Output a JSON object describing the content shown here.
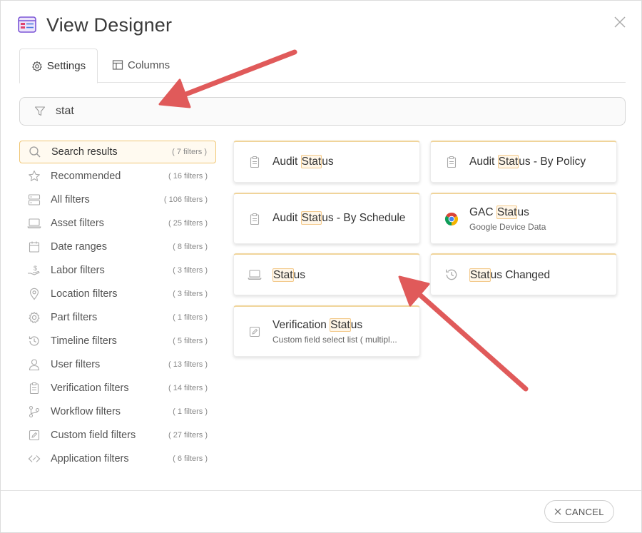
{
  "dialog": {
    "title": "View Designer",
    "close_icon": "close-icon",
    "logo_icon": "view-designer-logo-icon"
  },
  "tabs": [
    {
      "label": "Settings",
      "icon": "gear-icon",
      "active": true
    },
    {
      "label": "Columns",
      "icon": "columns-icon",
      "active": false
    }
  ],
  "search": {
    "value": "stat",
    "icon": "filter-icon"
  },
  "sidebar": {
    "items": [
      {
        "label": "Search results",
        "count": "( 7 filters )",
        "icon": "search-icon",
        "active": true
      },
      {
        "label": "Recommended",
        "count": "( 16 filters )",
        "icon": "star-icon"
      },
      {
        "label": "All filters",
        "count": "( 106 filters )",
        "icon": "server-icon"
      },
      {
        "label": "Asset filters",
        "count": "( 25 filters )",
        "icon": "laptop-icon"
      },
      {
        "label": "Date ranges",
        "count": "( 8 filters )",
        "icon": "calendar-icon"
      },
      {
        "label": "Labor filters",
        "count": "( 3 filters )",
        "icon": "hand-money-icon"
      },
      {
        "label": "Location filters",
        "count": "( 3 filters )",
        "icon": "location-pin-icon"
      },
      {
        "label": "Part filters",
        "count": "( 1 filters )",
        "icon": "gear-icon"
      },
      {
        "label": "Timeline filters",
        "count": "( 5 filters )",
        "icon": "history-icon"
      },
      {
        "label": "User filters",
        "count": "( 13 filters )",
        "icon": "user-icon"
      },
      {
        "label": "Verification filters",
        "count": "( 14 filters )",
        "icon": "clipboard-icon"
      },
      {
        "label": "Workflow filters",
        "count": "( 1 filters )",
        "icon": "workflow-branch-icon"
      },
      {
        "label": "Custom field filters",
        "count": "( 27 filters )",
        "icon": "edit-field-icon"
      },
      {
        "label": "Application filters",
        "count": "( 6 filters )",
        "icon": "application-code-icon"
      }
    ]
  },
  "results": [
    {
      "pre": "Audit ",
      "match": "Stat",
      "post": "us",
      "sub": "",
      "icon": "clipboard-icon"
    },
    {
      "pre": "Audit ",
      "match": "Stat",
      "post": "us - By Policy",
      "sub": "",
      "icon": "clipboard-icon"
    },
    {
      "pre": "Audit ",
      "match": "Stat",
      "post": "us - By Schedule",
      "sub": "",
      "icon": "clipboard-icon"
    },
    {
      "pre": "GAC ",
      "match": "Stat",
      "post": "us",
      "sub": "Google Device Data",
      "icon": "chrome-icon"
    },
    {
      "pre": "",
      "match": "Stat",
      "post": "us",
      "sub": "",
      "icon": "laptop-icon"
    },
    {
      "pre": "",
      "match": "Stat",
      "post": "us Changed",
      "sub": "",
      "icon": "history-icon"
    },
    {
      "pre": "Verification ",
      "match": "Stat",
      "post": "us",
      "sub": "Custom field select list ( multipl...",
      "icon": "edit-field-icon"
    }
  ],
  "footer": {
    "cancel_label": "CANCEL",
    "cancel_icon": "close-icon"
  },
  "annotations": {
    "arrow_color": "#e05a5a"
  }
}
